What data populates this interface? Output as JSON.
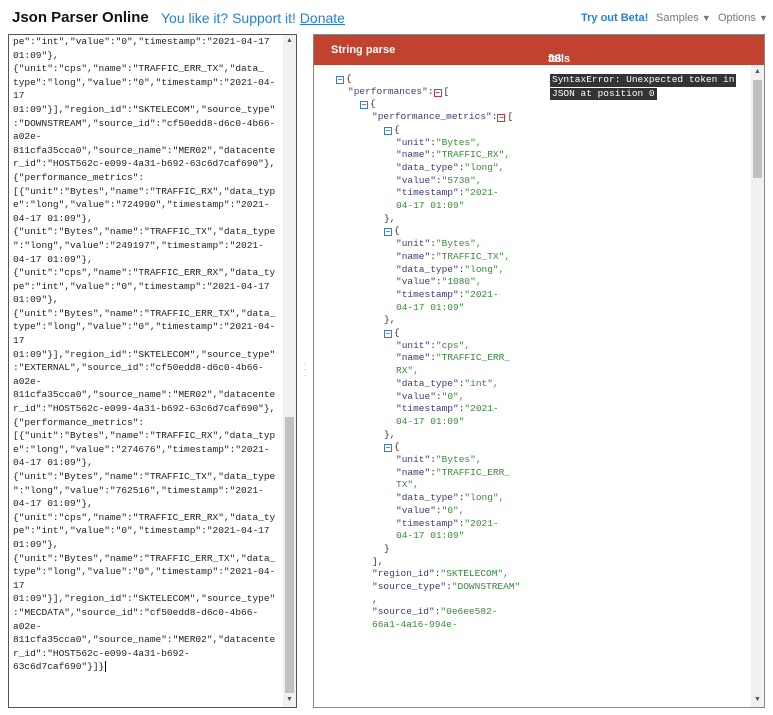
{
  "header": {
    "app_title": "Json Parser Online",
    "support_text": "You like it? Support it! ",
    "donate_link": "Donate",
    "try_beta": "Try out Beta!",
    "samples_menu": "Samples",
    "options_menu": "Options",
    "caret_glyph": "▼"
  },
  "input": {
    "lines": [
      "pe\":\"int\",\"value\":\"0\",\"timestamp\":\"2021-04-17",
      "01:09\"},",
      "{\"unit\":\"cps\",\"name\":\"TRAFFIC_ERR_TX\",\"data_",
      "type\":\"long\",\"value\":\"0\",\"timestamp\":\"2021-04-",
      "17",
      "01:09\"}],\"region_id\":\"SKTELECOM\",\"source_type\"",
      ":\"DOWNSTREAM\",\"source_id\":\"cf50edd8-d6c0-4b66-",
      "a02e-",
      "811cfa35cca0\",\"source_name\":\"MER02\",\"datacente",
      "r_id\":\"HOST562c-e099-4a31-b692-63c6d7caf690\"},",
      "{\"performance_metrics\":",
      "[{\"unit\":\"Bytes\",\"name\":\"TRAFFIC_RX\",\"data_typ",
      "e\":\"long\",\"value\":\"724990\",\"timestamp\":\"2021-",
      "04-17 01:09\"},",
      "{\"unit\":\"Bytes\",\"name\":\"TRAFFIC_TX\",\"data_type",
      "\":\"long\",\"value\":\"249197\",\"timestamp\":\"2021-",
      "04-17 01:09\"},",
      "{\"unit\":\"cps\",\"name\":\"TRAFFIC_ERR_RX\",\"data_ty",
      "pe\":\"int\",\"value\":\"0\",\"timestamp\":\"2021-04-17",
      "01:09\"},",
      "{\"unit\":\"Bytes\",\"name\":\"TRAFFIC_ERR_TX\",\"data_",
      "type\":\"long\",\"value\":\"0\",\"timestamp\":\"2021-04-",
      "17",
      "01:09\"}],\"region_id\":\"SKTELECOM\",\"source_type\"",
      ":\"EXTERNAL\",\"source_id\":\"cf50edd8-d6c0-4b66-",
      "a02e-",
      "811cfa35cca0\",\"source_name\":\"MER02\",\"datacente",
      "r_id\":\"HOST562c-e099-4a31-b692-63c6d7caf690\"},",
      "{\"performance_metrics\":",
      "[{\"unit\":\"Bytes\",\"name\":\"TRAFFIC_RX\",\"data_typ",
      "e\":\"long\",\"value\":\"274676\",\"timestamp\":\"2021-",
      "04-17 01:09\"},",
      "{\"unit\":\"Bytes\",\"name\":\"TRAFFIC_TX\",\"data_type",
      "\":\"long\",\"value\":\"762516\",\"timestamp\":\"2021-",
      "04-17 01:09\"},",
      "{\"unit\":\"cps\",\"name\":\"TRAFFIC_ERR_RX\",\"data_ty",
      "pe\":\"int\",\"value\":\"0\",\"timestamp\":\"2021-04-17",
      "01:09\"},",
      "{\"unit\":\"Bytes\",\"name\":\"TRAFFIC_ERR_TX\",\"data_",
      "type\":\"long\",\"value\":\"0\",\"timestamp\":\"2021-04-",
      "17",
      "01:09\"}],\"region_id\":\"SKTELECOM\",\"source_type\"",
      ":\"MECDATA\",\"source_id\":\"cf50edd8-d6c0-4b66-",
      "a02e-",
      "811cfa35cca0\",\"source_name\":\"MER02\",\"datacente",
      "r_id\":\"HOST562c-e099-4a31-b692-",
      "63c6d7caf690\"}]}"
    ]
  },
  "output": {
    "string_parse_label": "String parse",
    "js_eval_label": "JS eval ",
    "js_eval_status": "fails",
    "error_lines": [
      "SyntaxError: Unexpected token  in",
      "JSON at position 0"
    ],
    "tree": [
      {
        "indent": 0,
        "toggle": "blue",
        "text": "{"
      },
      {
        "indent": 1,
        "key": "\"performances\"",
        "punct": ":",
        "toggle": "red",
        "text": "["
      },
      {
        "indent": 2,
        "toggle": "blue",
        "text": "{"
      },
      {
        "indent": 3,
        "key": "\"performance_metrics\"",
        "punct": ":",
        "toggle": "red",
        "text": "["
      },
      {
        "indent": 4,
        "toggle": "blue",
        "text": "{"
      },
      {
        "indent": 5,
        "key": "\"unit\"",
        "punct": ":",
        "str": "\"Bytes\","
      },
      {
        "indent": 5,
        "key": "\"name\"",
        "punct": ":",
        "str": "\"TRAFFIC_RX\","
      },
      {
        "indent": 5,
        "key": "\"data_type\"",
        "punct": ":",
        "str": "\"long\","
      },
      {
        "indent": 5,
        "key": "\"value\"",
        "punct": ":",
        "str": "\"5738\","
      },
      {
        "indent": 5,
        "key": "\"timestamp\"",
        "punct": ":",
        "str": "\"2021-"
      },
      {
        "indent": 5,
        "str": "04-17 01:09\""
      },
      {
        "indent": 4,
        "text": "},"
      },
      {
        "indent": 4,
        "toggle": "blue",
        "text": "{"
      },
      {
        "indent": 5,
        "key": "\"unit\"",
        "punct": ":",
        "str": "\"Bytes\","
      },
      {
        "indent": 5,
        "key": "\"name\"",
        "punct": ":",
        "str": "\"TRAFFIC_TX\","
      },
      {
        "indent": 5,
        "key": "\"data_type\"",
        "punct": ":",
        "str": "\"long\","
      },
      {
        "indent": 5,
        "key": "\"value\"",
        "punct": ":",
        "str": "\"1080\","
      },
      {
        "indent": 5,
        "key": "\"timestamp\"",
        "punct": ":",
        "str": "\"2021-"
      },
      {
        "indent": 5,
        "str": "04-17 01:09\""
      },
      {
        "indent": 4,
        "text": "},"
      },
      {
        "indent": 4,
        "toggle": "blue",
        "text": "{"
      },
      {
        "indent": 5,
        "key": "\"unit\"",
        "punct": ":",
        "str": "\"cps\","
      },
      {
        "indent": 5,
        "key": "\"name\"",
        "punct": ":",
        "str": "\"TRAFFIC_ERR_"
      },
      {
        "indent": 5,
        "str": "RX\","
      },
      {
        "indent": 5,
        "key": "\"data_type\"",
        "punct": ":",
        "str": "\"int\","
      },
      {
        "indent": 5,
        "key": "\"value\"",
        "punct": ":",
        "str": "\"0\","
      },
      {
        "indent": 5,
        "key": "\"timestamp\"",
        "punct": ":",
        "str": "\"2021-"
      },
      {
        "indent": 5,
        "str": "04-17 01:09\""
      },
      {
        "indent": 4,
        "text": "},"
      },
      {
        "indent": 4,
        "toggle": "blue",
        "text": "{"
      },
      {
        "indent": 5,
        "key": "\"unit\"",
        "punct": ":",
        "str": "\"Bytes\","
      },
      {
        "indent": 5,
        "key": "\"name\"",
        "punct": ":",
        "str": "\"TRAFFIC_ERR_"
      },
      {
        "indent": 5,
        "str": "TX\","
      },
      {
        "indent": 5,
        "key": "\"data_type\"",
        "punct": ":",
        "str": "\"long\","
      },
      {
        "indent": 5,
        "key": "\"value\"",
        "punct": ":",
        "str": "\"0\","
      },
      {
        "indent": 5,
        "key": "\"timestamp\"",
        "punct": ":",
        "str": "\"2021-"
      },
      {
        "indent": 5,
        "str": "04-17 01:09\""
      },
      {
        "indent": 4,
        "text": "}"
      },
      {
        "indent": 3,
        "text": "],"
      },
      {
        "indent": 3,
        "key": "\"region_id\"",
        "punct": ":",
        "str": "\"SKTELECOM\","
      },
      {
        "indent": 3,
        "key": "\"source_type\"",
        "punct": ":",
        "str": "\"DOWNSTREAM\""
      },
      {
        "indent": 3,
        "text": ","
      },
      {
        "indent": 3,
        "key": "\"source_id\"",
        "punct": ":",
        "str": "\"0e6ee582-"
      },
      {
        "indent": 3,
        "str": "66a1-4a16-994e-"
      }
    ]
  },
  "colors": {
    "brand_blue": "#2a7fd4",
    "header_red": "#c1432f",
    "json_key": "#3b3b7a",
    "json_string": "#3a8a3a"
  }
}
